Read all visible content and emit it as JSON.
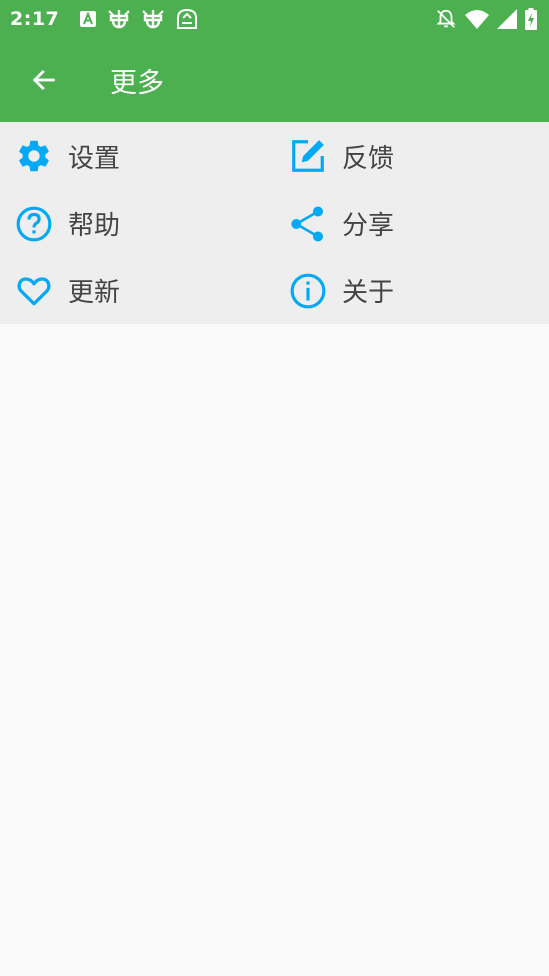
{
  "status_bar": {
    "time": "2:17",
    "icons": [
      "a-app-icon",
      "bug-icon",
      "bug-icon",
      "sim-icon",
      "bell-off-icon",
      "wifi-icon",
      "signal-icon",
      "battery-charging-icon"
    ]
  },
  "app_bar": {
    "title": "更多",
    "back_icon": "arrow-left-icon"
  },
  "colors": {
    "primary": "#4caf50",
    "accent": "#03a9f4",
    "panel": "#eeeeee",
    "background": "#fafafa"
  },
  "menu": {
    "items": [
      {
        "label": "设置",
        "icon": "gear-icon"
      },
      {
        "label": "反馈",
        "icon": "edit-icon"
      },
      {
        "label": "帮助",
        "icon": "help-icon"
      },
      {
        "label": "分享",
        "icon": "share-icon"
      },
      {
        "label": "更新",
        "icon": "heart-icon"
      },
      {
        "label": "关于",
        "icon": "info-icon"
      }
    ]
  }
}
